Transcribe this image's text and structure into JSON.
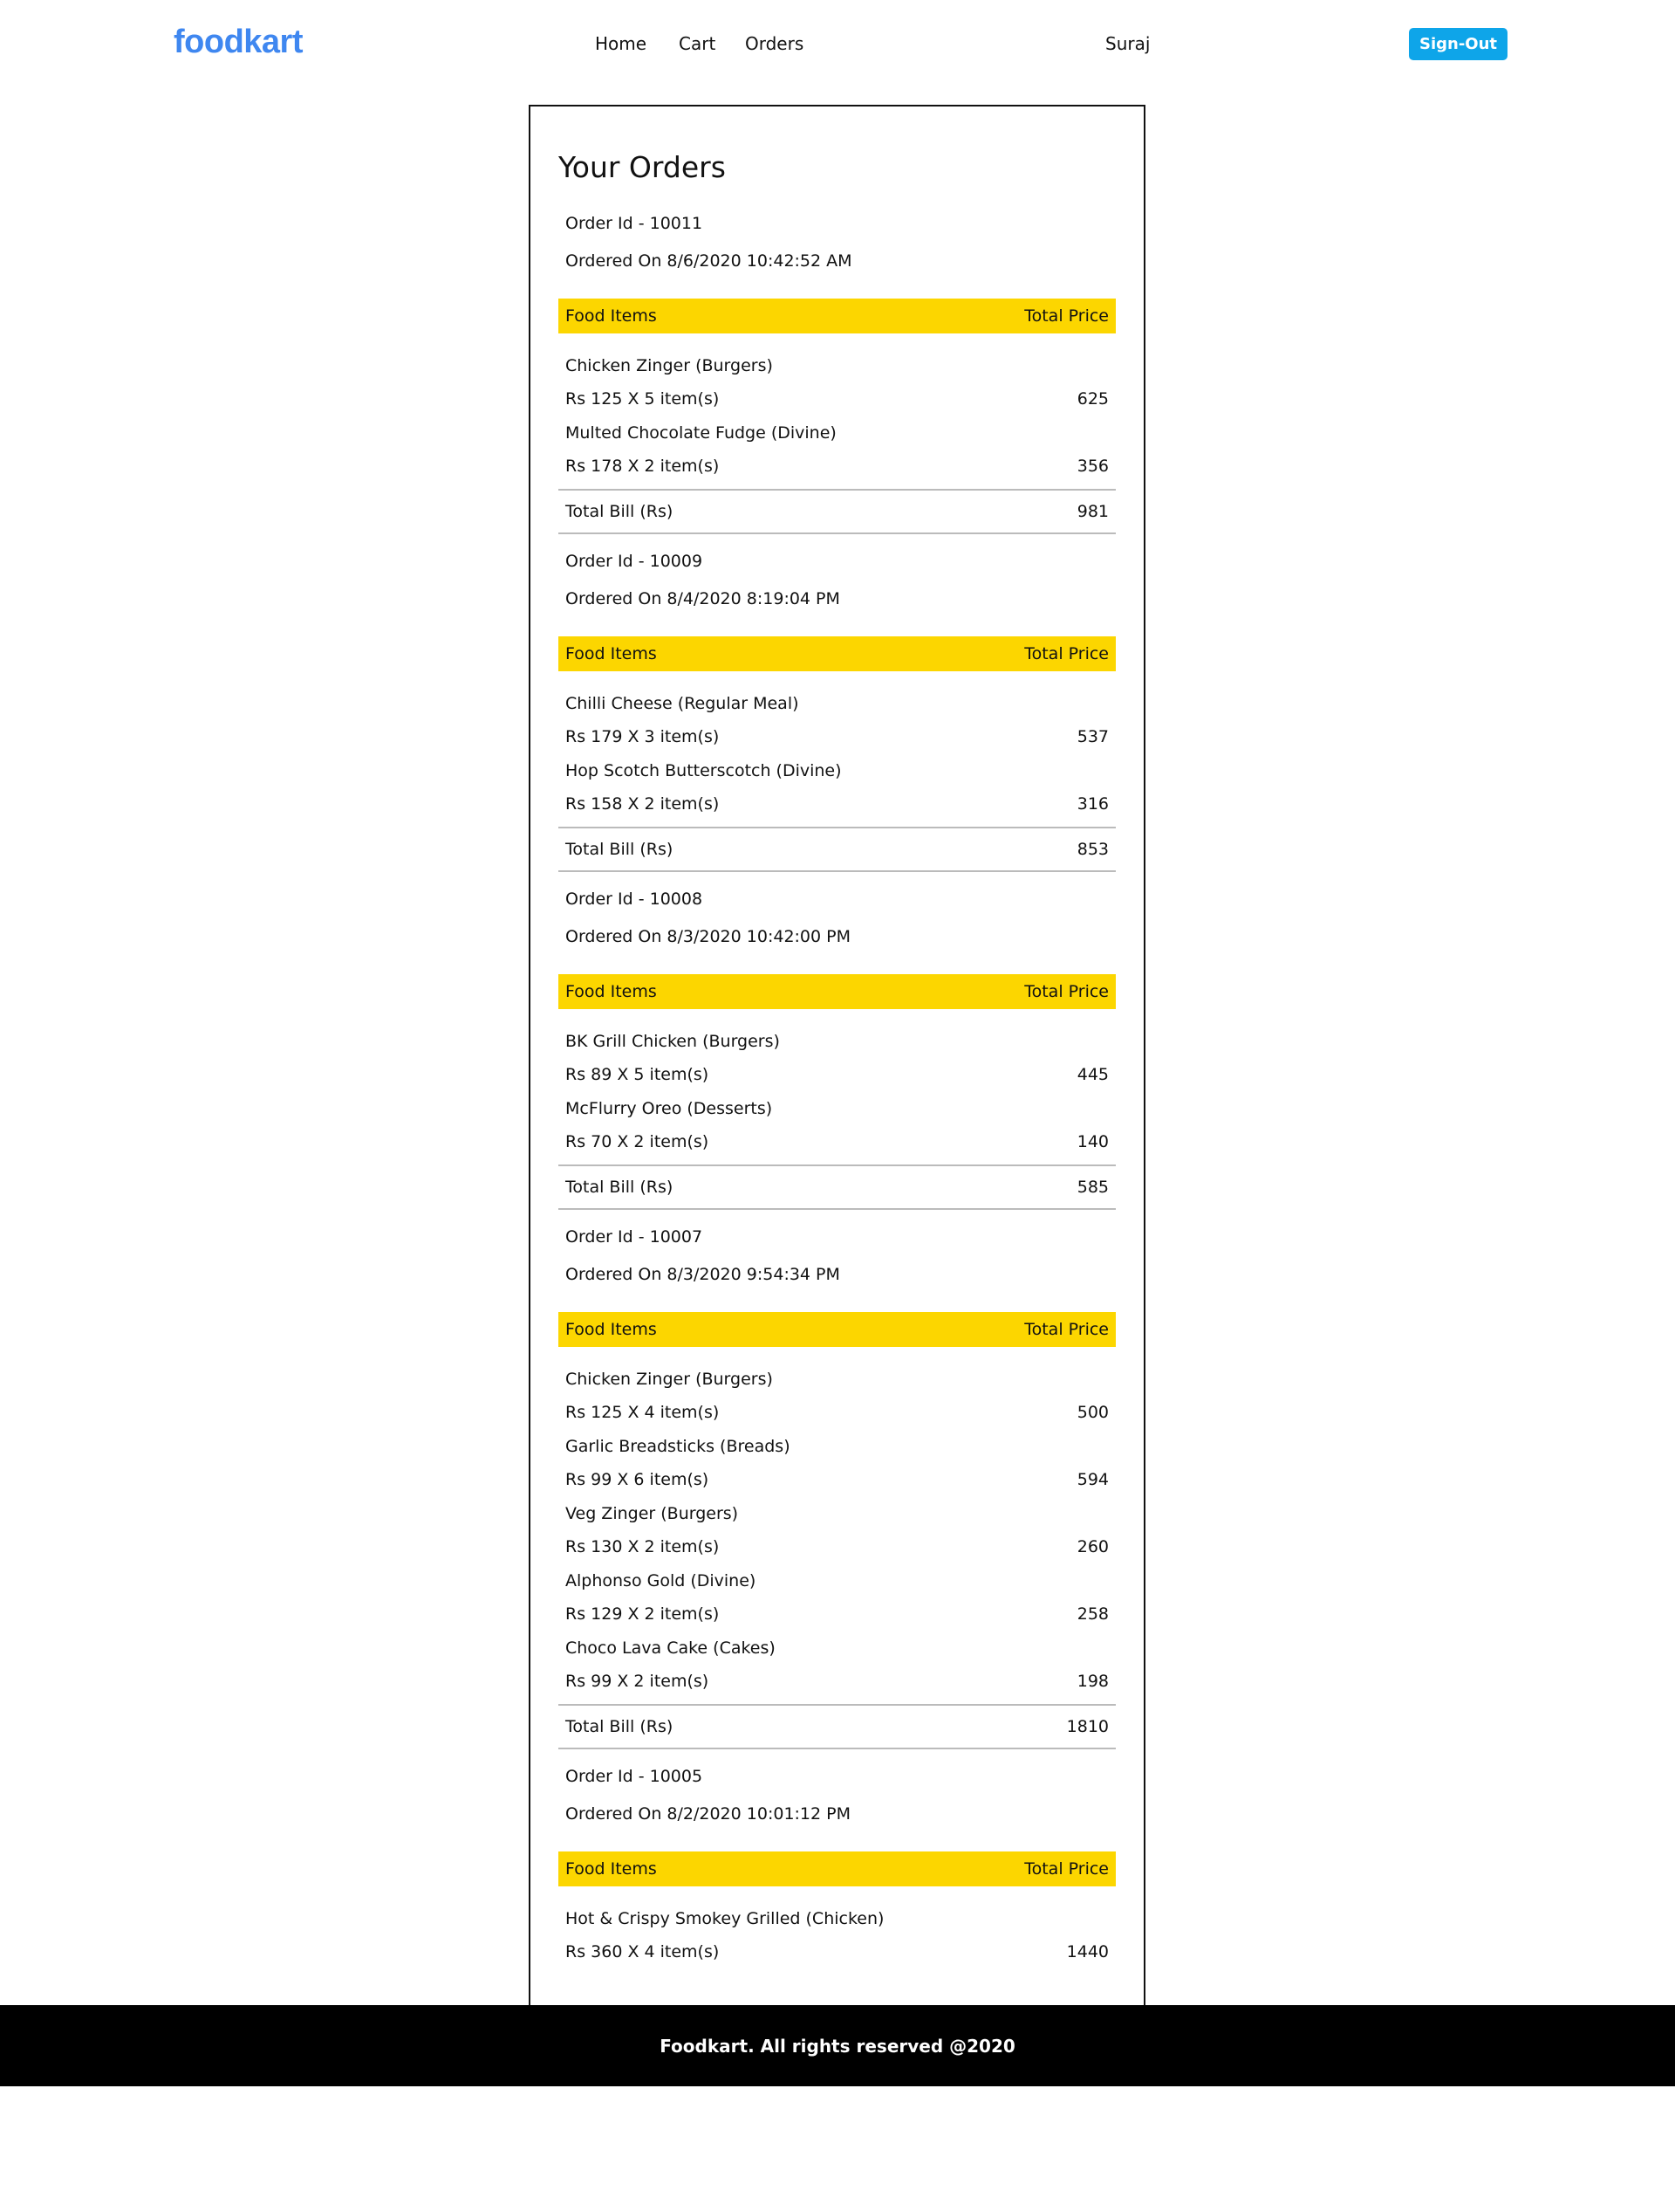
{
  "nav": {
    "logo": "foodkart",
    "links": [
      "Home",
      "Cart",
      "Orders"
    ],
    "user": "Suraj",
    "signout": "Sign-Out"
  },
  "page": {
    "title": "Your Orders",
    "food_items_header": "Food Items",
    "total_price_header": "Total Price",
    "total_bill_label": "Total Bill (Rs)"
  },
  "orders": [
    {
      "order_id": "Order Id - 10011",
      "ordered_on": "Ordered On 8/6/2020 10:42:52 AM",
      "items": [
        {
          "name": "Chicken Zinger (Burgers)",
          "qty_line": "Rs 125 X 5 item(s)",
          "price": "625"
        },
        {
          "name": "Multed Chocolate Fudge (Divine)",
          "qty_line": "Rs 178 X 2 item(s)",
          "price": "356"
        }
      ],
      "total": "981"
    },
    {
      "order_id": "Order Id - 10009",
      "ordered_on": "Ordered On 8/4/2020 8:19:04 PM",
      "items": [
        {
          "name": "Chilli Cheese (Regular Meal)",
          "qty_line": "Rs 179 X 3 item(s)",
          "price": "537"
        },
        {
          "name": "Hop Scotch Butterscotch (Divine)",
          "qty_line": "Rs 158 X 2 item(s)",
          "price": "316"
        }
      ],
      "total": "853"
    },
    {
      "order_id": "Order Id - 10008",
      "ordered_on": "Ordered On 8/3/2020 10:42:00 PM",
      "items": [
        {
          "name": "BK Grill Chicken (Burgers)",
          "qty_line": "Rs 89 X 5 item(s)",
          "price": "445"
        },
        {
          "name": "McFlurry Oreo (Desserts)",
          "qty_line": "Rs 70 X 2 item(s)",
          "price": "140"
        }
      ],
      "total": "585"
    },
    {
      "order_id": "Order Id - 10007",
      "ordered_on": "Ordered On 8/3/2020 9:54:34 PM",
      "items": [
        {
          "name": "Chicken Zinger (Burgers)",
          "qty_line": "Rs 125 X 4 item(s)",
          "price": "500"
        },
        {
          "name": "Garlic Breadsticks (Breads)",
          "qty_line": "Rs 99 X 6 item(s)",
          "price": "594"
        },
        {
          "name": "Veg Zinger (Burgers)",
          "qty_line": "Rs 130 X 2 item(s)",
          "price": "260"
        },
        {
          "name": "Alphonso Gold (Divine)",
          "qty_line": "Rs 129 X 2 item(s)",
          "price": "258"
        },
        {
          "name": "Choco Lava Cake (Cakes)",
          "qty_line": "Rs 99 X 2 item(s)",
          "price": "198"
        }
      ],
      "total": "1810"
    },
    {
      "order_id": "Order Id - 10005",
      "ordered_on": "Ordered On 8/2/2020 10:01:12 PM",
      "items": [
        {
          "name": "Hot & Crispy Smokey Grilled (Chicken)",
          "qty_line": "Rs 360 X 4 item(s)",
          "price": "1440"
        }
      ],
      "total": null
    }
  ],
  "footer": {
    "text": "Foodkart. All rights reserved @2020"
  }
}
